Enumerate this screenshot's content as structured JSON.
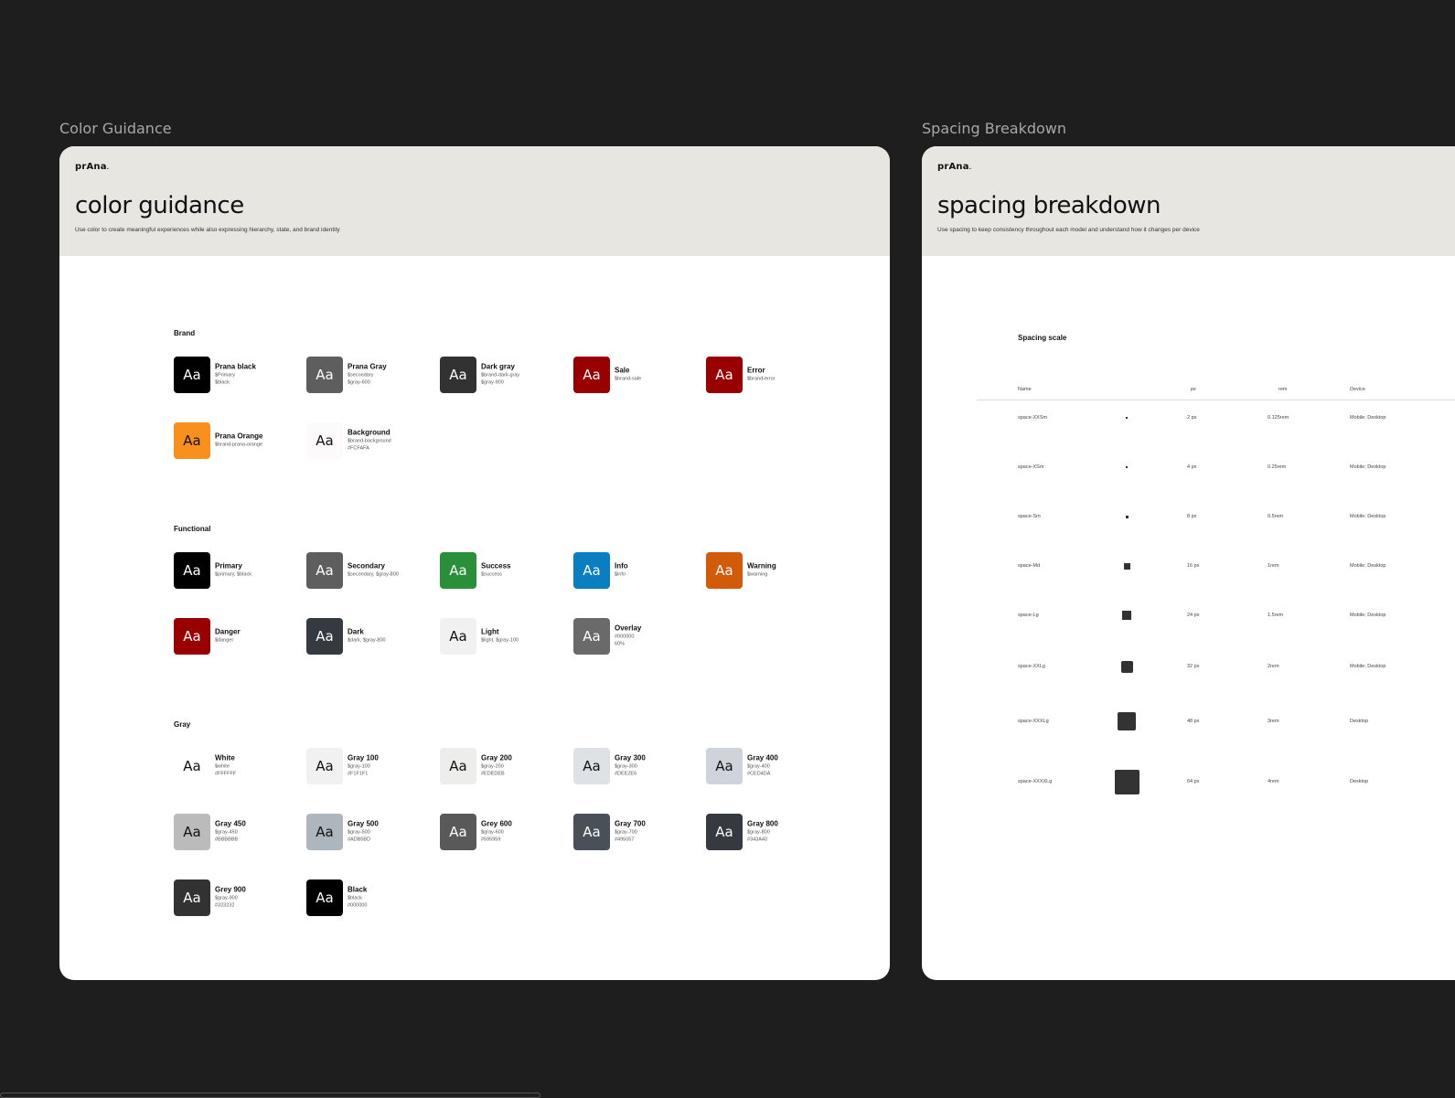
{
  "frames": {
    "color": {
      "label": "Color Guidance",
      "logo": "prAna",
      "title": "color guidance",
      "subtitle": "Use color to create meaningful experiences while also expressing hierarchy, state, and brand identity",
      "swatch_text": "Aa",
      "sections": [
        {
          "title": "Brand",
          "items": [
            {
              "name": "Prana black",
              "lines": [
                "$Primary",
                "$black"
              ],
              "color": "#000000",
              "text_color": "#ffffff"
            },
            {
              "name": "Prana Gray",
              "lines": [
                "$secondary",
                "$gray-600"
              ],
              "color": "#5e5e5e",
              "text_color": "#ffffff"
            },
            {
              "name": "Dark gray",
              "lines": [
                "$brand-dark-gray",
                "$gray-900"
              ],
              "color": "#323232",
              "text_color": "#ffffff"
            },
            {
              "name": "Sale",
              "lines": [
                "$brand-sale"
              ],
              "color": "#990000",
              "text_color": "#ffffff"
            },
            {
              "name": "Error",
              "lines": [
                "$brand-error"
              ],
              "color": "#990000",
              "text_color": "#ffffff"
            },
            {
              "name": "Prana Orange",
              "lines": [
                "$brand-prana-orange"
              ],
              "color": "#f8901e",
              "text_color": "#111111"
            },
            {
              "name": "Background",
              "lines": [
                "$brand-background",
                "#FCFAFA"
              ],
              "color": "#fcfafa",
              "text_color": "#111111"
            }
          ]
        },
        {
          "title": "Functional",
          "items": [
            {
              "name": "Primary",
              "lines": [
                "$primary, $black"
              ],
              "color": "#000000",
              "text_color": "#ffffff"
            },
            {
              "name": "Secondary",
              "lines": [
                "$secondary, $gray-800"
              ],
              "color": "#5e5e5e",
              "text_color": "#ffffff"
            },
            {
              "name": "Success",
              "lines": [
                "$success"
              ],
              "color": "#2a8f39",
              "text_color": "#ffffff"
            },
            {
              "name": "Info",
              "lines": [
                "$info"
              ],
              "color": "#0b7dc1",
              "text_color": "#ffffff"
            },
            {
              "name": "Warning",
              "lines": [
                "$warning"
              ],
              "color": "#d15b0a",
              "text_color": "#ffffff"
            },
            {
              "name": "Danger",
              "lines": [
                "$danger"
              ],
              "color": "#990000",
              "text_color": "#ffffff"
            },
            {
              "name": "Dark",
              "lines": [
                "$dark, $gray-800"
              ],
              "color": "#343a40",
              "text_color": "#ffffff"
            },
            {
              "name": "Light",
              "lines": [
                "$light, $gray-100"
              ],
              "color": "#f1f1f1",
              "text_color": "#111111"
            },
            {
              "name": "Overlay",
              "lines": [
                "#000000",
                "60%"
              ],
              "color": "#6a6a6a",
              "text_color": "#ffffff"
            }
          ]
        },
        {
          "title": "Gray",
          "items": [
            {
              "name": "White",
              "lines": [
                "$white",
                "#FFFFFF"
              ],
              "color": "#ffffff",
              "text_color": "#111111"
            },
            {
              "name": "Gray 100",
              "lines": [
                "$gray-100",
                "#F1F1F1"
              ],
              "color": "#f1f1f1",
              "text_color": "#111111"
            },
            {
              "name": "Gray 200",
              "lines": [
                "$gray-200",
                "#EDEDEB"
              ],
              "color": "#ededeb",
              "text_color": "#111111"
            },
            {
              "name": "Gray 300",
              "lines": [
                "$gray-300",
                "#DEE2E6"
              ],
              "color": "#dee2e6",
              "text_color": "#111111"
            },
            {
              "name": "Gray 400",
              "lines": [
                "$gray-400",
                "#CED4DA"
              ],
              "color": "#ced4da",
              "text_color": "#111111"
            },
            {
              "name": "Gray 450",
              "lines": [
                "$gray-450",
                "#BBBBBB"
              ],
              "color": "#bbbbbb",
              "text_color": "#111111"
            },
            {
              "name": "Gray 500",
              "lines": [
                "$gray-500",
                "#ADB5BD"
              ],
              "color": "#adb5bd",
              "text_color": "#111111"
            },
            {
              "name": "Grey 600",
              "lines": [
                "$gray-600",
                "#595959"
              ],
              "color": "#595959",
              "text_color": "#ffffff"
            },
            {
              "name": "Gray 700",
              "lines": [
                "$gray-700",
                "#495057"
              ],
              "color": "#495057",
              "text_color": "#ffffff"
            },
            {
              "name": "Gray 800",
              "lines": [
                "$gray-800",
                "#343A40"
              ],
              "color": "#343a40",
              "text_color": "#ffffff"
            },
            {
              "name": "Grey 900",
              "lines": [
                "$gray-900",
                "#323232"
              ],
              "color": "#323232",
              "text_color": "#ffffff"
            },
            {
              "name": "Black",
              "lines": [
                "$black",
                "#000000"
              ],
              "color": "#000000",
              "text_color": "#ffffff"
            }
          ]
        }
      ]
    },
    "spacing": {
      "label": "Spacing Breakdown",
      "logo": "prAna",
      "title": "spacing breakdown",
      "subtitle": "Use spacing to keep consistency throughout each model and understand how it changes per device",
      "scale_title": "Spacing scale",
      "columns": {
        "name": "Name",
        "px": "px",
        "rem": "rem",
        "device": "Device"
      },
      "rows": [
        {
          "name": "space-XXSm",
          "value": 2,
          "px": "2 px",
          "rem": "0.125rem",
          "device": "Mobile; Desktop"
        },
        {
          "name": "space-XSm",
          "value": 4,
          "px": "4 px",
          "rem": "0.25rem",
          "device": "Mobile; Desktop"
        },
        {
          "name": "space-Sm",
          "value": 8,
          "px": "8 px",
          "rem": "0.5rem",
          "device": "Mobile; Desktop"
        },
        {
          "name": "space-Md",
          "value": 16,
          "px": "16 px",
          "rem": "1rem",
          "device": "Mobile; Desktop"
        },
        {
          "name": "space-Lg",
          "value": 24,
          "px": "24 px",
          "rem": "1.5rem",
          "device": "Mobile; Desktop"
        },
        {
          "name": "space-XXLg",
          "value": 32,
          "px": "32 px",
          "rem": "2rem",
          "device": "Mobile; Desktop"
        },
        {
          "name": "space-XXXLg",
          "value": 48,
          "px": "48 px",
          "rem": "3rem",
          "device": "Desktop"
        },
        {
          "name": "space-XXXXLg",
          "value": 64,
          "px": "64 px",
          "rem": "4rem",
          "device": "Desktop"
        }
      ]
    }
  }
}
